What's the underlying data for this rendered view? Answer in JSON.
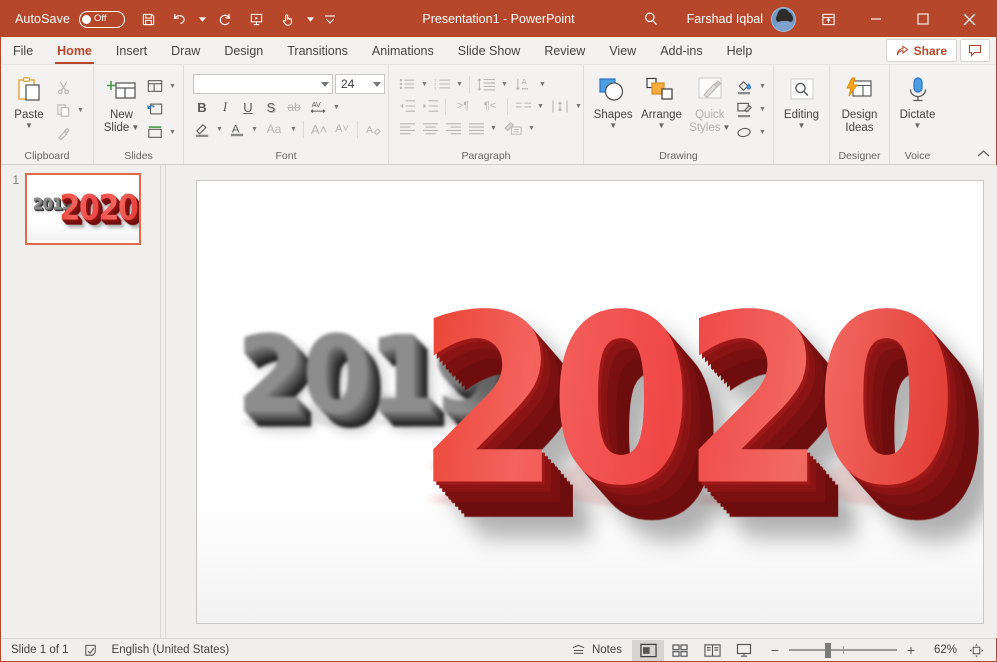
{
  "titlebar": {
    "autosave_label": "AutoSave",
    "autosave_state": "Off",
    "title": "Presentation1  -  PowerPoint",
    "user_name": "Farshad Iqbal",
    "qat": [
      {
        "name": "save-icon",
        "label": "Save"
      },
      {
        "name": "undo-icon",
        "label": "Undo"
      },
      {
        "name": "redo-icon",
        "label": "Redo"
      },
      {
        "name": "start-from-beginning-icon",
        "label": "Start From Beginning"
      },
      {
        "name": "touch-mouse-mode-icon",
        "label": "Touch/Mouse Mode"
      },
      {
        "name": "customize-qat-icon",
        "label": "Customize Quick Access Toolbar"
      }
    ],
    "window_controls": {
      "ribbon_display": "Ribbon Display Options",
      "minimize": "Minimize",
      "restore": "Restore Down",
      "close": "Close"
    },
    "accent_color": "#b7472a"
  },
  "tabs": [
    {
      "label": "File",
      "active": false
    },
    {
      "label": "Home",
      "active": true
    },
    {
      "label": "Insert",
      "active": false
    },
    {
      "label": "Draw",
      "active": false
    },
    {
      "label": "Design",
      "active": false
    },
    {
      "label": "Transitions",
      "active": false
    },
    {
      "label": "Animations",
      "active": false
    },
    {
      "label": "Slide Show",
      "active": false
    },
    {
      "label": "Review",
      "active": false
    },
    {
      "label": "View",
      "active": false
    },
    {
      "label": "Add-ins",
      "active": false
    },
    {
      "label": "Help",
      "active": false
    }
  ],
  "tab_actions": {
    "share_label": "Share",
    "comments_label": "Comments"
  },
  "ribbon": {
    "groups": [
      {
        "name": "clipboard",
        "title": "Clipboard",
        "paste_label": "Paste",
        "items": [
          "Cut",
          "Copy",
          "Format Painter"
        ]
      },
      {
        "name": "slides",
        "title": "Slides",
        "new_slide_label": "New\nSlide",
        "new_slide_line1": "New",
        "new_slide_line2": "Slide",
        "items": [
          "Layout",
          "Reset",
          "Section"
        ]
      },
      {
        "name": "font",
        "title": "Font",
        "font_name_value": "",
        "font_size_value": "24",
        "items": [
          "Bold",
          "Italic",
          "Underline",
          "Text Shadow",
          "Strikethrough",
          "Character Spacing",
          "Text Highlight Color",
          "Font Color",
          "Change Case",
          "Increase Font Size",
          "Decrease Font Size",
          "Clear All Formatting"
        ]
      },
      {
        "name": "paragraph",
        "title": "Paragraph",
        "items": [
          "Bullets",
          "Numbering",
          "Line Spacing",
          "Text Direction",
          "Decrease Indent",
          "Increase Indent",
          "Decrease List Level",
          "Increase List Level",
          "Columns",
          "Align Text",
          "Align Left",
          "Center",
          "Align Right",
          "Justify",
          "Convert to SmartArt"
        ]
      },
      {
        "name": "drawing",
        "title": "Drawing",
        "shapes_label": "Shapes",
        "arrange_label": "Arrange",
        "quick_styles_line1": "Quick",
        "quick_styles_line2": "Styles",
        "items": [
          "Shape Fill",
          "Shape Outline",
          "Shape Effects"
        ]
      },
      {
        "name": "editing",
        "title": "",
        "editing_label": "Editing"
      },
      {
        "name": "designer",
        "title": "Designer",
        "design_ideas_line1": "Design",
        "design_ideas_line2": "Ideas"
      },
      {
        "name": "voice",
        "title": "Voice",
        "dictate_label": "Dictate"
      }
    ],
    "collapse_label": "Collapse the Ribbon"
  },
  "thumbnails": [
    {
      "number": "1",
      "selected": true
    }
  ],
  "slide": {
    "old_year": "2019",
    "new_year": "2020",
    "old_year_color": "#8d8d8d",
    "new_year_color": "#ef4646",
    "background": "#ffffff"
  },
  "status": {
    "slide_count_label": "Slide 1 of 1",
    "spellcheck_icon": "spellcheck-icon",
    "language": "English (United States)",
    "notes_label": "Notes",
    "views": [
      {
        "name": "normal-view-button",
        "label": "Normal",
        "active": true
      },
      {
        "name": "slide-sorter-view-button",
        "label": "Slide Sorter",
        "active": false
      },
      {
        "name": "reading-view-button",
        "label": "Reading View",
        "active": false
      },
      {
        "name": "slide-show-button",
        "label": "Slide Show",
        "active": false
      }
    ],
    "zoom_out_label": "−",
    "zoom_in_label": "+",
    "zoom_percent": "62%",
    "fit_label": "Fit slide to current window"
  }
}
